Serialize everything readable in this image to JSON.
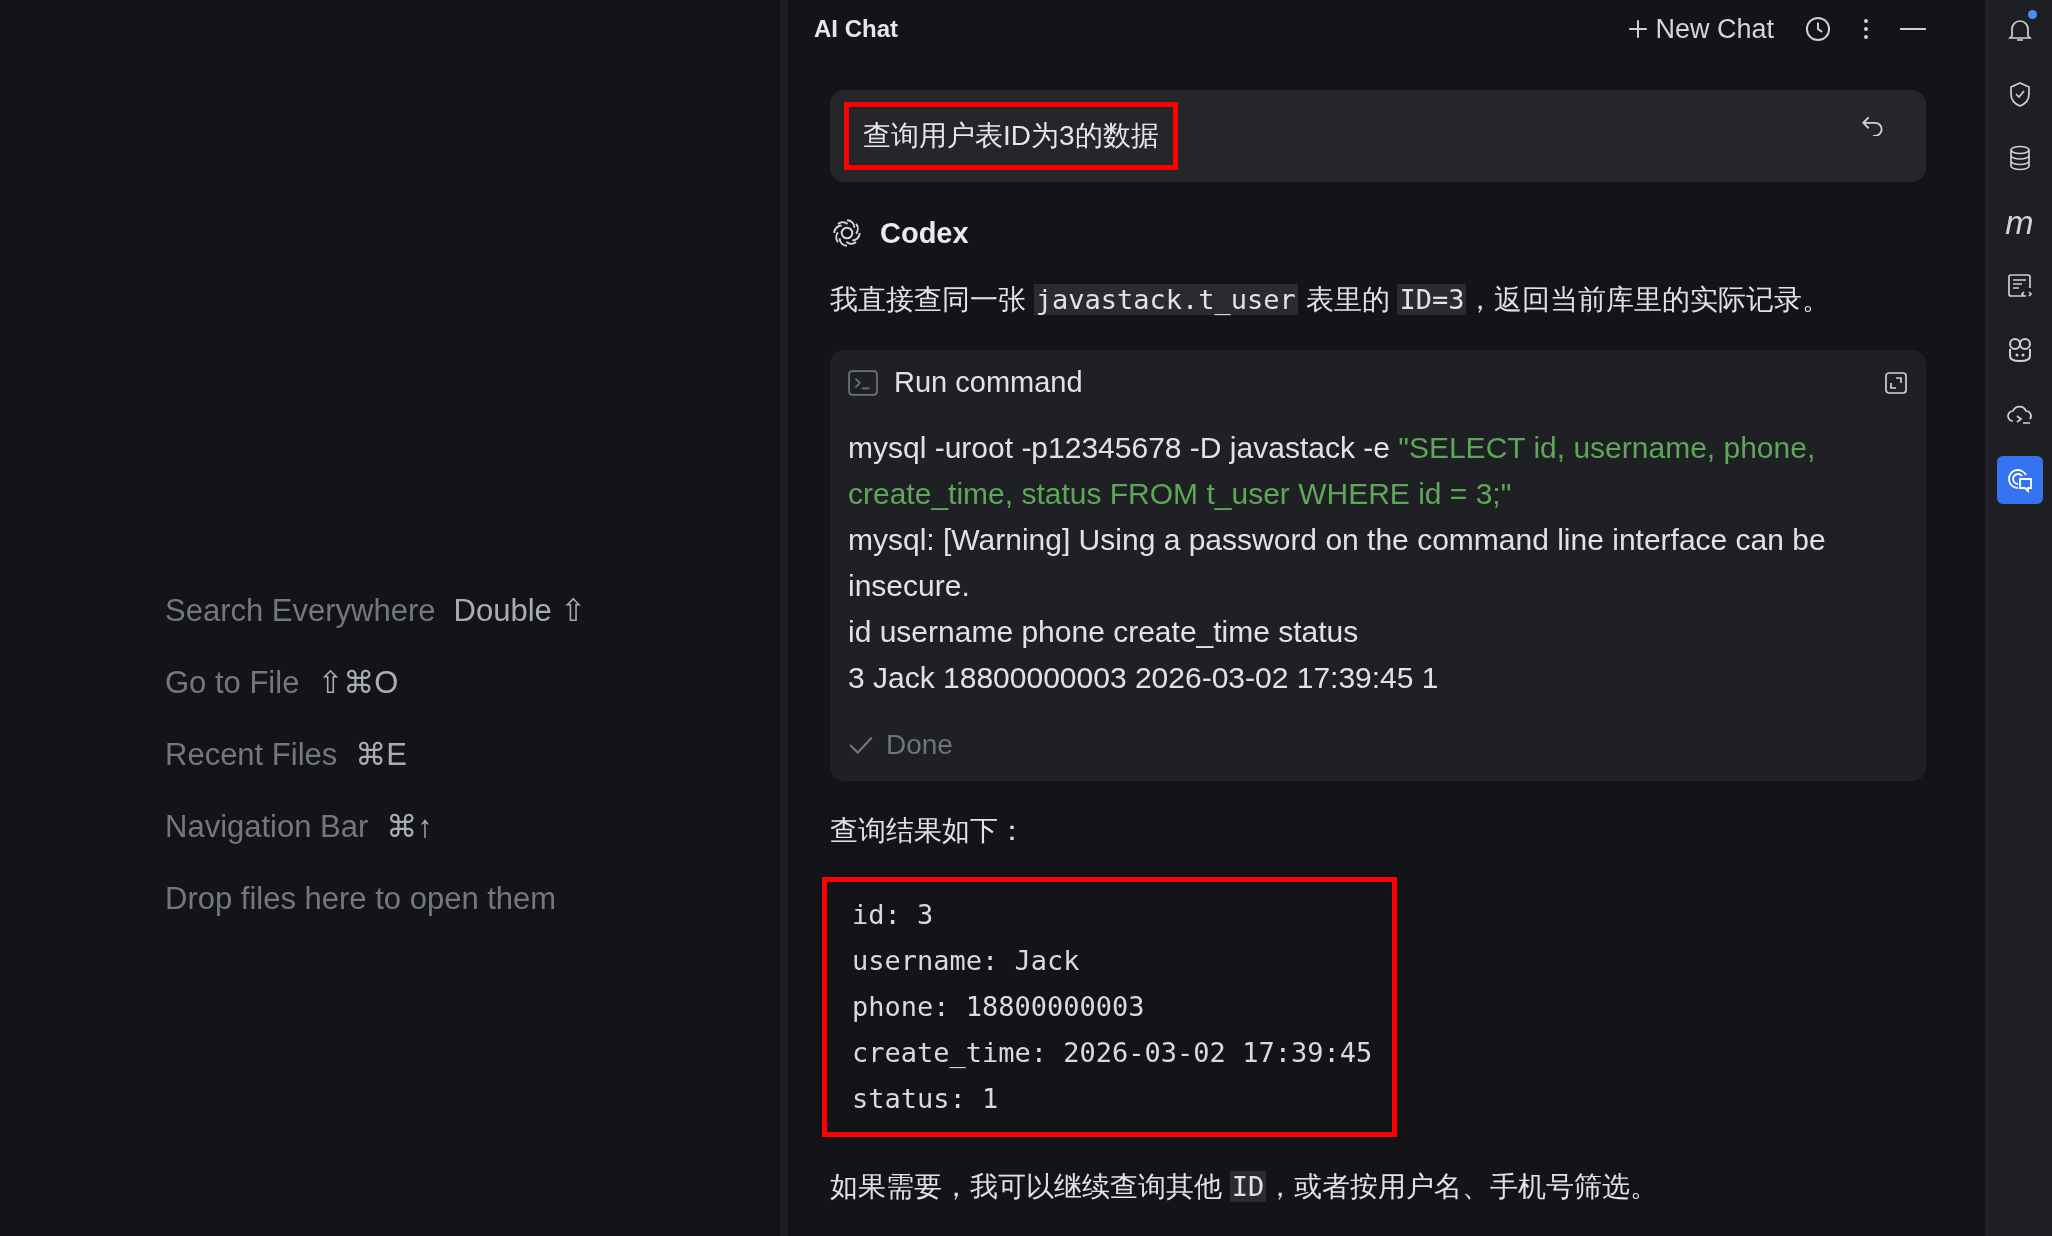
{
  "welcome": {
    "hints": [
      {
        "label": "Search Everywhere",
        "shortcut": "Double ⇧"
      },
      {
        "label": "Go to File",
        "shortcut": "⇧⌘O"
      },
      {
        "label": "Recent Files",
        "shortcut": "⌘E"
      },
      {
        "label": "Navigation Bar",
        "shortcut": "⌘↑"
      },
      {
        "label": "Drop files here to open them"
      }
    ]
  },
  "chat": {
    "title": "AI Chat",
    "new_chat": "New Chat",
    "user_message": {
      "text": "查询用户表ID为3的数据",
      "highlighted": true
    },
    "assistant": {
      "name": "Codex",
      "intro": [
        {
          "text": "我直接查同一张 ",
          "code": false
        },
        {
          "text": "javastack.t_user",
          "code": true
        },
        {
          "text": " 表里的 ",
          "code": false
        },
        {
          "text": "ID=3",
          "code": true
        },
        {
          "text": "，返回当前库里的实际记录。",
          "code": false
        }
      ],
      "command": {
        "title": "Run command",
        "command": "mysql -uroot -p12345678 -D javastack -e ",
        "query": "\"SELECT id, username, phone, create_time, status FROM t_user WHERE id = 3;\"",
        "output": [
          "mysql: [Warning] Using a password on the command line interface can be insecure.",
          "id username phone create_time status",
          "3 Jack 18800000003 2026-03-02 17:39:45 1"
        ],
        "status": "Done",
        "done": true
      },
      "result_heading": "查询结果如下：",
      "result": {
        "lines": [
          "id: 3",
          "username: Jack",
          "phone: 18800000003",
          "create_time: 2026-03-02 17:39:45",
          "status: 1"
        ],
        "highlighted": true
      },
      "closing": [
        {
          "text": "如果需要，我可以继续查询其他 ",
          "code": false
        },
        {
          "text": "ID",
          "code": true
        },
        {
          "text": "，或者按用户名、手机号筛选。",
          "code": false
        }
      ]
    }
  },
  "toolbar": [
    {
      "kind": "bell",
      "badge": true,
      "selected": false
    },
    {
      "kind": "shield",
      "badge": false,
      "selected": false
    },
    {
      "kind": "database",
      "badge": false,
      "selected": false
    },
    {
      "kind": "glyph",
      "glyph": "m",
      "badge": false,
      "selected": false
    },
    {
      "kind": "doc",
      "badge": false,
      "selected": false
    },
    {
      "kind": "robot",
      "badge": false,
      "selected": false
    },
    {
      "kind": "cloud",
      "badge": false,
      "selected": false
    },
    {
      "kind": "chat",
      "badge": false,
      "selected": true
    }
  ]
}
